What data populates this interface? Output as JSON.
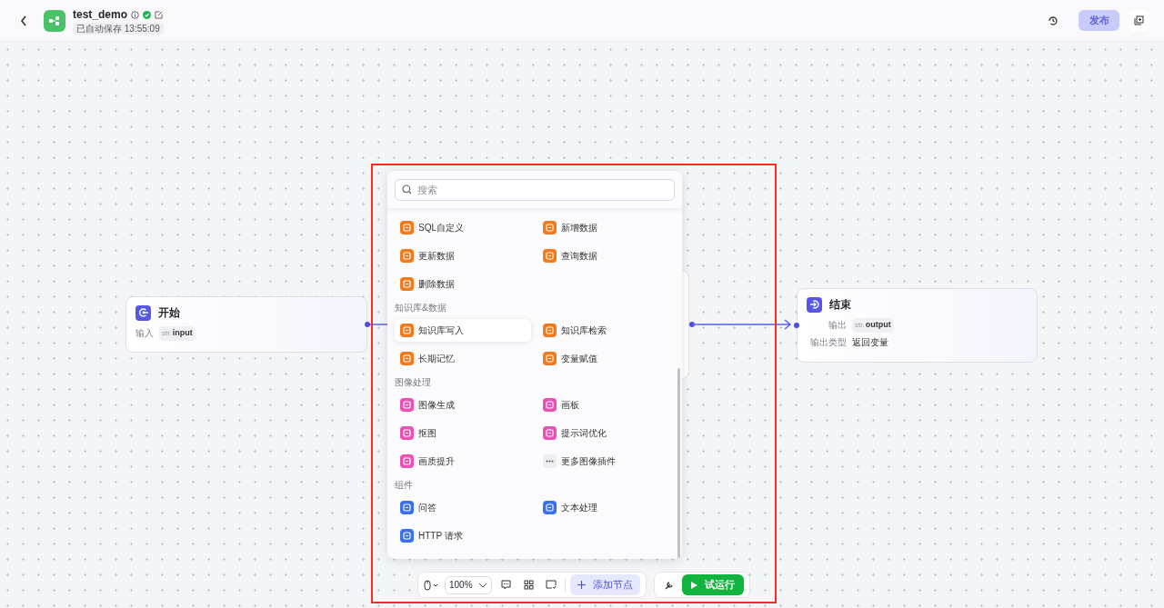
{
  "header": {
    "title": "test_demo",
    "saved": "已自动保存 13:55:09",
    "publish": {
      "label": "发布",
      "disabled": true
    }
  },
  "nodes": [
    {
      "kind": "start",
      "title": "开始",
      "fields": [
        {
          "kind": "tag",
          "label": "输入",
          "type": "str.",
          "value": "input"
        }
      ]
    },
    {
      "kind": "end",
      "title": "结束",
      "fields": [
        {
          "kind": "tag",
          "label": "输出",
          "type": "str.",
          "value": "output"
        },
        {
          "kind": "text",
          "label": "输出类型",
          "value": "返回变量"
        }
      ]
    }
  ],
  "menu": {
    "search": {
      "placeholder": "搜索"
    },
    "sections": [
      {
        "items": [
          {
            "label": "SQL自定义",
            "color": "#f27a1a",
            "selected": false
          },
          {
            "label": "新增数据",
            "color": "#f27a1a",
            "selected": false
          },
          {
            "label": "更新数据",
            "color": "#f27a1a",
            "selected": false
          },
          {
            "label": "查询数据",
            "color": "#f27a1a",
            "selected": false
          },
          {
            "label": "删除数据",
            "color": "#f27a1a",
            "selected": false
          }
        ]
      },
      {
        "title": "知识库&数据",
        "items": [
          {
            "label": "知识库写入",
            "color": "#f27a1a",
            "selected": true
          },
          {
            "label": "知识库检索",
            "color": "#f27a1a",
            "selected": false
          },
          {
            "label": "长期记忆",
            "color": "#f27a1a",
            "selected": false
          },
          {
            "label": "变量赋值",
            "color": "#f27a1a",
            "selected": false
          }
        ]
      },
      {
        "title": "图像处理",
        "items": [
          {
            "label": "图像生成",
            "color": "#ec4fb5",
            "selected": false
          },
          {
            "label": "画板",
            "color": "#ec4fb5",
            "selected": false
          },
          {
            "label": "抠图",
            "color": "#ec4fb5",
            "selected": false
          },
          {
            "label": "提示词优化",
            "color": "#ec4fb5",
            "selected": false
          },
          {
            "label": "画质提升",
            "color": "#ec4fb5",
            "selected": false
          },
          {
            "label": "更多图像插件",
            "color": "#eceef2",
            "selected": false
          }
        ]
      },
      {
        "title": "组件",
        "items": [
          {
            "label": "问答",
            "color": "#3a6ff0",
            "selected": false
          },
          {
            "label": "文本处理",
            "color": "#3a6ff0",
            "selected": false
          },
          {
            "label": "HTTP 请求",
            "color": "#3a6ff0",
            "selected": false
          }
        ]
      }
    ]
  },
  "toolbar": {
    "zoom": "100%",
    "add_node": "添加节点",
    "run": "试运行"
  }
}
